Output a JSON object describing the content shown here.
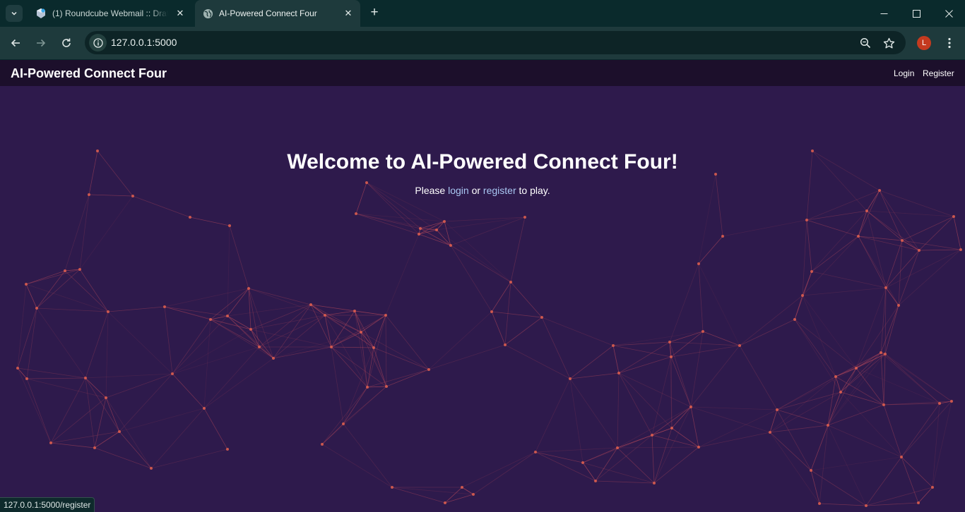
{
  "browser": {
    "tabs": [
      {
        "title": "(1) Roundcube Webmail :: Drafts",
        "active": false,
        "favicon": "roundcube-icon"
      },
      {
        "title": "AI-Powered Connect Four",
        "active": true,
        "favicon": "globe-icon"
      }
    ],
    "address": "127.0.0.1:5000",
    "profile_initial": "L",
    "status_url": "127.0.0.1:5000/register"
  },
  "navbar": {
    "brand": "AI-Powered Connect Four",
    "links": {
      "login": "Login",
      "register": "Register"
    }
  },
  "hero": {
    "title": "Welcome to AI-Powered Connect Four!",
    "prefix": "Please ",
    "login_link": "login",
    "middle": " or ",
    "register_link": "register",
    "suffix": " to play."
  },
  "colors": {
    "background": "#2e1a4c",
    "navbar": "#1c0f2b",
    "link": "#a9c7f2",
    "network_node": "#e0604f",
    "network_line": "#b5485a"
  }
}
